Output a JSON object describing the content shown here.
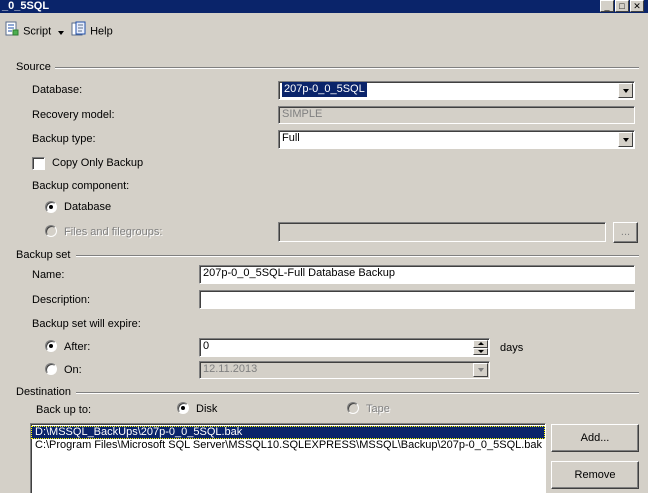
{
  "window": {
    "title": "_0_5SQL"
  },
  "toolbar": {
    "script_label": "Script",
    "help_label": "Help"
  },
  "source": {
    "title": "Source",
    "database_label": "Database:",
    "database_value": "207p-0_0_5SQL",
    "recovery_label": "Recovery model:",
    "recovery_value": "SIMPLE",
    "backup_type_label": "Backup type:",
    "backup_type_value": "Full",
    "copy_only_label": "Copy Only Backup",
    "component_label": "Backup component:",
    "component_database": "Database",
    "component_files": "Files and filegroups:",
    "browse_label": "..."
  },
  "backup_set": {
    "title": "Backup set",
    "name_label": "Name:",
    "name_value": "207p-0_0_5SQL-Full Database Backup",
    "description_label": "Description:",
    "description_value": "",
    "expire_label": "Backup set will expire:",
    "after_label": "After:",
    "after_value": "0",
    "days_label": "days",
    "on_label": "On:",
    "on_value": "12.11.2013"
  },
  "destination": {
    "title": "Destination",
    "backup_to_label": "Back up to:",
    "disk_label": "Disk",
    "tape_label": "Tape",
    "paths": [
      "D:\\MSSQL_BackUps\\207p-0_0_5SQL.bak",
      "C:\\Program Files\\Microsoft SQL Server\\MSSQL10.SQLEXPRESS\\MSSQL\\Backup\\207p-0_0_5SQL.bak"
    ],
    "add_label": "Add...",
    "remove_label": "Remove"
  }
}
